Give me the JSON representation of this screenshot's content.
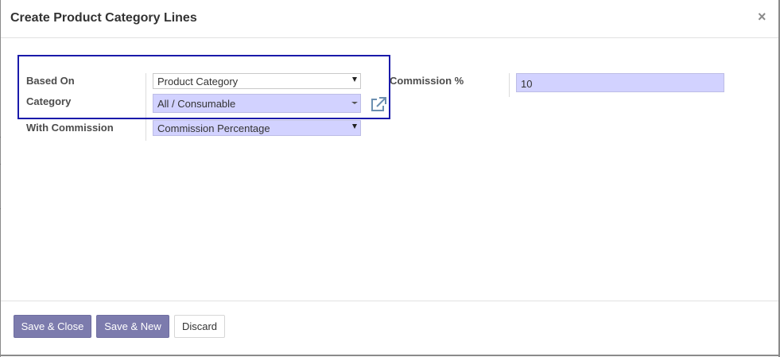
{
  "dialog": {
    "title": "Create Product Category Lines",
    "close_glyph": "×"
  },
  "form": {
    "based_on": {
      "label": "Based On",
      "value": "Product Category"
    },
    "category": {
      "label": "Category",
      "value": "All / Consumable"
    },
    "with_commission": {
      "label": "With Commission",
      "value": "Commission Percentage"
    },
    "commission_pct": {
      "label": "Commission %",
      "value": "10"
    }
  },
  "footer": {
    "save_close": "Save & Close",
    "save_new": "Save & New",
    "discard": "Discard"
  },
  "colors": {
    "required_field_bg": "#d2d2ff",
    "primary_button": "#7c7bad",
    "highlight_border": "#1a1aaa"
  },
  "icons": {
    "external_link": "external-link-icon",
    "close": "close-icon"
  }
}
